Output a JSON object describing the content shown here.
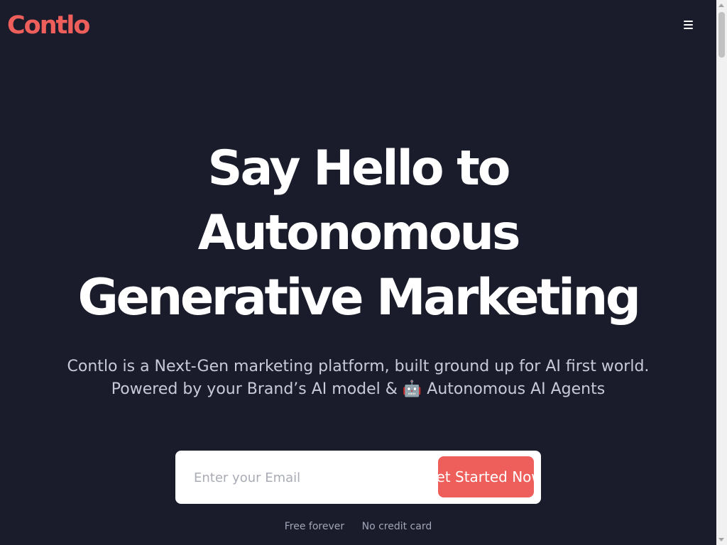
{
  "header": {
    "logo_text": "Contlo",
    "menu_icon": "hamburger-menu-icon"
  },
  "hero": {
    "headline_lines": [
      "Say Hello to",
      "Autonomous",
      "Generative Marketing"
    ],
    "subtitle_lines": [
      "Contlo is a Next-Gen marketing platform, built ground up for AI first world.",
      "Powered by your Brand’s AI model & 🤖 Autonomous AI Agents"
    ]
  },
  "signup": {
    "email_placeholder": "Enter your Email",
    "email_value": "",
    "cta_label": "Get Started Now"
  },
  "notes": {
    "free": "Free forever",
    "no_card": "No credit card"
  },
  "colors": {
    "background": "#1a1c2b",
    "brand": "#ee5f5b",
    "text": "#ffffff"
  }
}
